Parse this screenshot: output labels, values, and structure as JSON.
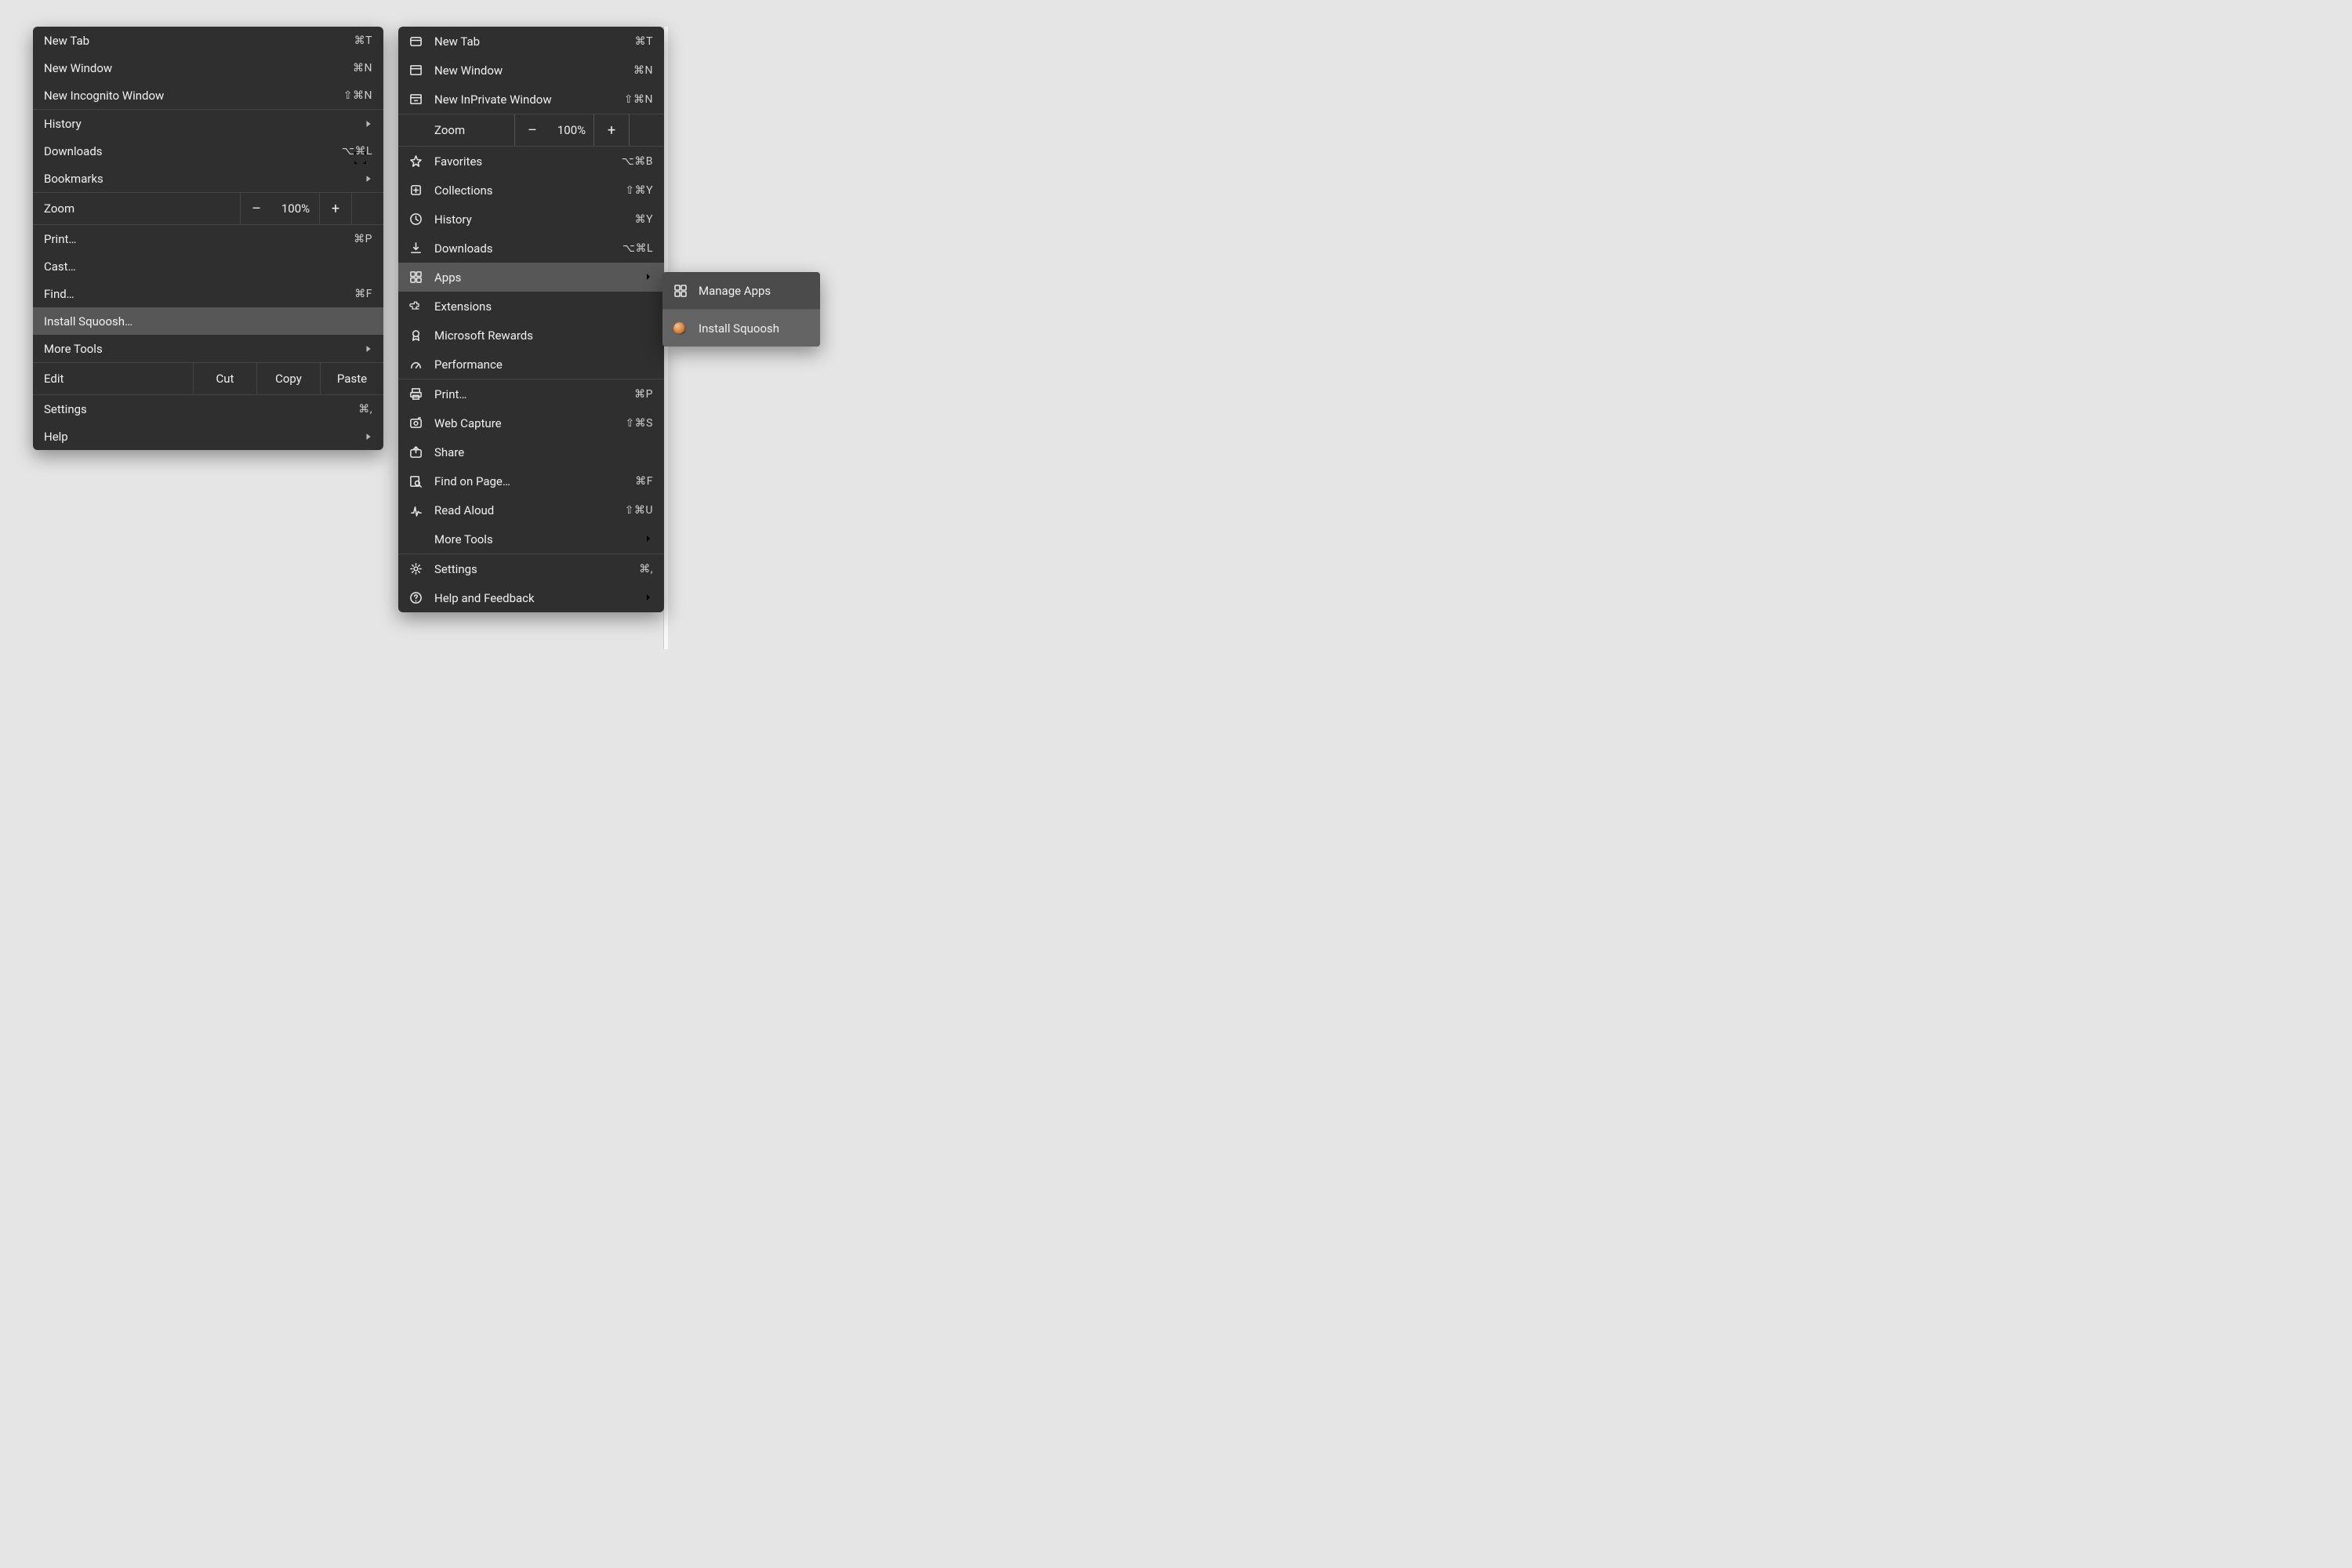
{
  "chrome": {
    "g1": [
      {
        "label": "New Tab",
        "short": "⌘T"
      },
      {
        "label": "New Window",
        "short": "⌘N"
      },
      {
        "label": "New Incognito Window",
        "short": "⇧⌘N"
      }
    ],
    "g2": [
      {
        "label": "History",
        "arrow": true
      },
      {
        "label": "Downloads",
        "short": "⌥⌘L"
      },
      {
        "label": "Bookmarks",
        "arrow": true
      }
    ],
    "zoom": {
      "label": "Zoom",
      "value": "100%",
      "minus": "–",
      "plus": "+"
    },
    "g3": [
      {
        "label": "Print…",
        "short": "⌘P"
      },
      {
        "label": "Cast…"
      },
      {
        "label": "Find…",
        "short": "⌘F"
      },
      {
        "label": "Install Squoosh…",
        "hl": true
      },
      {
        "label": "More Tools",
        "arrow": true
      }
    ],
    "edit": {
      "label": "Edit",
      "cut": "Cut",
      "copy": "Copy",
      "paste": "Paste"
    },
    "g4": [
      {
        "label": "Settings",
        "short": "⌘,"
      },
      {
        "label": "Help",
        "arrow": true
      }
    ]
  },
  "edge": {
    "g1": [
      {
        "label": "New Tab",
        "short": "⌘T",
        "icon": "tab"
      },
      {
        "label": "New Window",
        "short": "⌘N",
        "icon": "window"
      },
      {
        "label": "New InPrivate Window",
        "short": "⇧⌘N",
        "icon": "inprivate"
      }
    ],
    "zoom": {
      "label": "Zoom",
      "value": "100%",
      "minus": "–",
      "plus": "+"
    },
    "g2": [
      {
        "label": "Favorites",
        "short": "⌥⌘B",
        "icon": "star"
      },
      {
        "label": "Collections",
        "short": "⇧⌘Y",
        "icon": "collections"
      },
      {
        "label": "History",
        "short": "⌘Y",
        "icon": "history"
      },
      {
        "label": "Downloads",
        "short": "⌥⌘L",
        "icon": "download"
      },
      {
        "label": "Apps",
        "arrow": true,
        "icon": "apps",
        "hl": true
      },
      {
        "label": "Extensions",
        "icon": "ext"
      },
      {
        "label": "Microsoft Rewards",
        "icon": "reward"
      },
      {
        "label": "Performance",
        "icon": "perf"
      }
    ],
    "g3": [
      {
        "label": "Print…",
        "short": "⌘P",
        "icon": "print"
      },
      {
        "label": "Web Capture",
        "short": "⇧⌘S",
        "icon": "capture"
      },
      {
        "label": "Share",
        "icon": "share"
      },
      {
        "label": "Find on Page…",
        "short": "⌘F",
        "icon": "find"
      },
      {
        "label": "Read Aloud",
        "short": "⇧⌘U",
        "icon": "read"
      },
      {
        "label": "More Tools",
        "arrow": true
      }
    ],
    "g4": [
      {
        "label": "Settings",
        "short": "⌘,",
        "icon": "settings"
      },
      {
        "label": "Help and Feedback",
        "arrow": true,
        "icon": "help"
      }
    ]
  },
  "submenu": [
    {
      "label": "Manage Apps",
      "icon": "apps"
    },
    {
      "label": "Install Squoosh",
      "icon": "squoosh",
      "hl": true
    }
  ]
}
